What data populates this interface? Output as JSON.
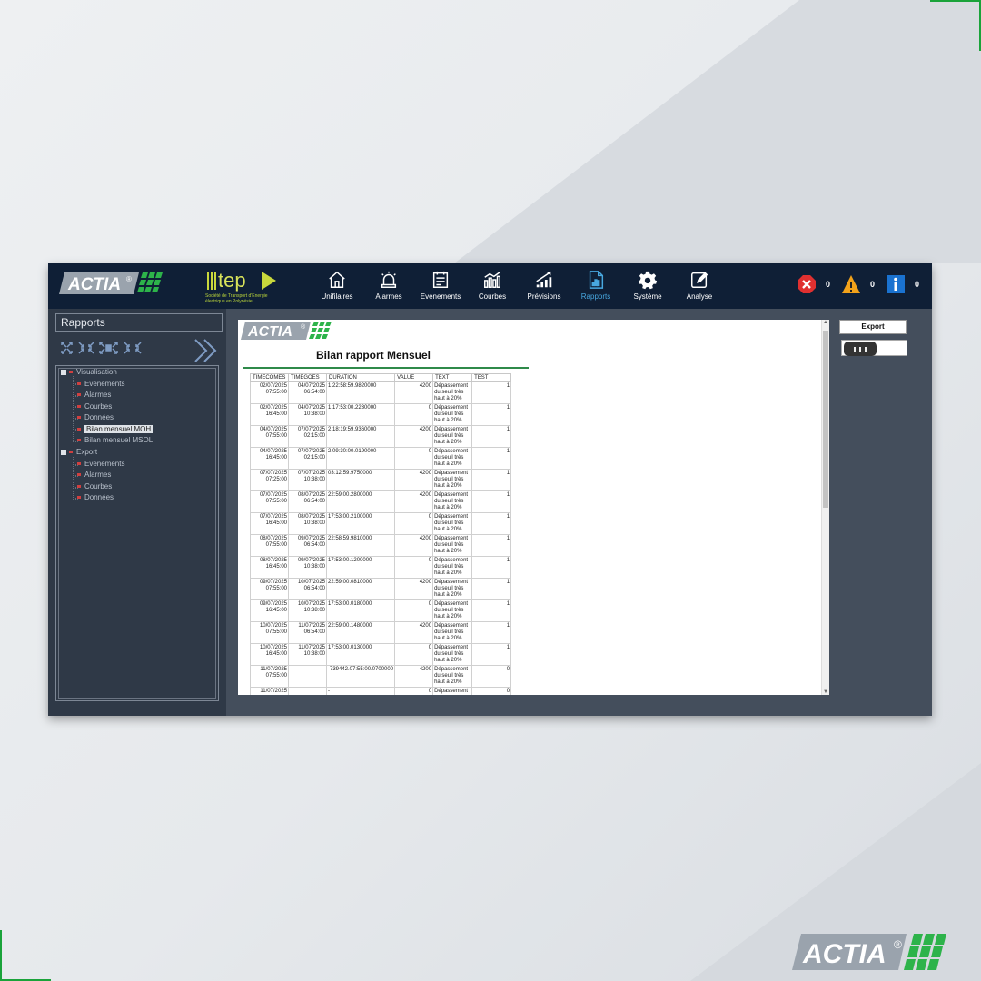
{
  "nav": {
    "items": [
      {
        "label": "Unifilaires",
        "icon": "home-icon"
      },
      {
        "label": "Alarmes",
        "icon": "siren-icon"
      },
      {
        "label": "Evenements",
        "icon": "list-icon"
      },
      {
        "label": "Courbes",
        "icon": "bar-chart-icon"
      },
      {
        "label": "Prévisions",
        "icon": "trend-icon"
      },
      {
        "label": "Rapports",
        "icon": "report-icon"
      },
      {
        "label": "Système",
        "icon": "gear-icon"
      },
      {
        "label": "Analyse",
        "icon": "edit-icon"
      }
    ],
    "active": "Rapports"
  },
  "brand": {
    "actia": "ACTIA",
    "registered": "®",
    "tep": "tep",
    "tep_caption": "Société de Transport d'Energie électrique en Polynésie"
  },
  "alerts": {
    "errors": "0",
    "warnings": "0",
    "info": "0"
  },
  "left_panel": {
    "title": "Rapports",
    "tree": {
      "visualisation": "Visualisation",
      "vis_items": [
        "Evenements",
        "Alarmes",
        "Courbes",
        "Données",
        "Bilan mensuel MOH",
        "Bilan mensuel MSOL"
      ],
      "export": "Export",
      "export_items": [
        "Evenements",
        "Alarmes",
        "Courbes",
        "Données"
      ]
    }
  },
  "report": {
    "title": "Bilan rapport Mensuel",
    "columns": [
      "TIMECOMES",
      "TIMEGOES",
      "DURATION",
      "VALUE",
      "TEXT",
      "TEST"
    ],
    "rows": [
      [
        "02/07/2025 07:55:00",
        "04/07/2025 06:54:00",
        "1.22:58:59.9820000",
        "4200",
        "Dépassement du seuil très haut à 20%",
        "1"
      ],
      [
        "02/07/2025 16:45:00",
        "04/07/2025 10:38:00",
        "1.17:53:00.2230000",
        "0",
        "Dépassement du seuil très haut à 20%",
        "1"
      ],
      [
        "04/07/2025 07:55:00",
        "07/07/2025 02:15:00",
        "2.18:19:59.9360000",
        "4200",
        "Dépassement du seuil très haut à 20%",
        "1"
      ],
      [
        "04/07/2025 16:45:00",
        "07/07/2025 02:15:00",
        "2.09:30:00.0190000",
        "0",
        "Dépassement du seuil très haut à 20%",
        "1"
      ],
      [
        "07/07/2025 07:25:00",
        "07/07/2025 10:38:00",
        "03:12:59.9750000",
        "4200",
        "Dépassement du seuil très haut à 20%",
        "1"
      ],
      [
        "07/07/2025 07:55:00",
        "08/07/2025 06:54:00",
        "22:59:00.2800000",
        "4200",
        "Dépassement du seuil très haut à 20%",
        "1"
      ],
      [
        "07/07/2025 16:45:00",
        "08/07/2025 10:38:00",
        "17:53:00.2100000",
        "0",
        "Dépassement du seuil très haut à 20%",
        "1"
      ],
      [
        "08/07/2025 07:55:00",
        "09/07/2025 06:54:00",
        "22:58:59.9810000",
        "4200",
        "Dépassement du seuil très haut à 20%",
        "1"
      ],
      [
        "08/07/2025 16:45:00",
        "09/07/2025 10:38:00",
        "17:53:00.1200000",
        "0",
        "Dépassement du seuil très haut à 20%",
        "1"
      ],
      [
        "09/07/2025 07:55:00",
        "10/07/2025 06:54:00",
        "22:59:00.0810000",
        "4200",
        "Dépassement du seuil très haut à 20%",
        "1"
      ],
      [
        "09/07/2025 16:45:00",
        "10/07/2025 10:38:00",
        "17:53:00.0180000",
        "0",
        "Dépassement du seuil très haut à 20%",
        "1"
      ],
      [
        "10/07/2025 07:55:00",
        "11/07/2025 06:54:00",
        "22:59:00.1480000",
        "4200",
        "Dépassement du seuil très haut à 20%",
        "1"
      ],
      [
        "10/07/2025 16:45:00",
        "11/07/2025 10:38:00",
        "17:53:00.0130000",
        "0",
        "Dépassement du seuil très haut à 20%",
        "1"
      ],
      [
        "11/07/2025 07:55:00",
        "",
        "-739442.07:55:00.0700000",
        "4200",
        "Dépassement du seuil très haut à 20%",
        "0"
      ],
      [
        "11/07/2025",
        "",
        "-",
        "0",
        "Dépassement",
        "0"
      ]
    ]
  },
  "export": {
    "button_label": "Export"
  }
}
